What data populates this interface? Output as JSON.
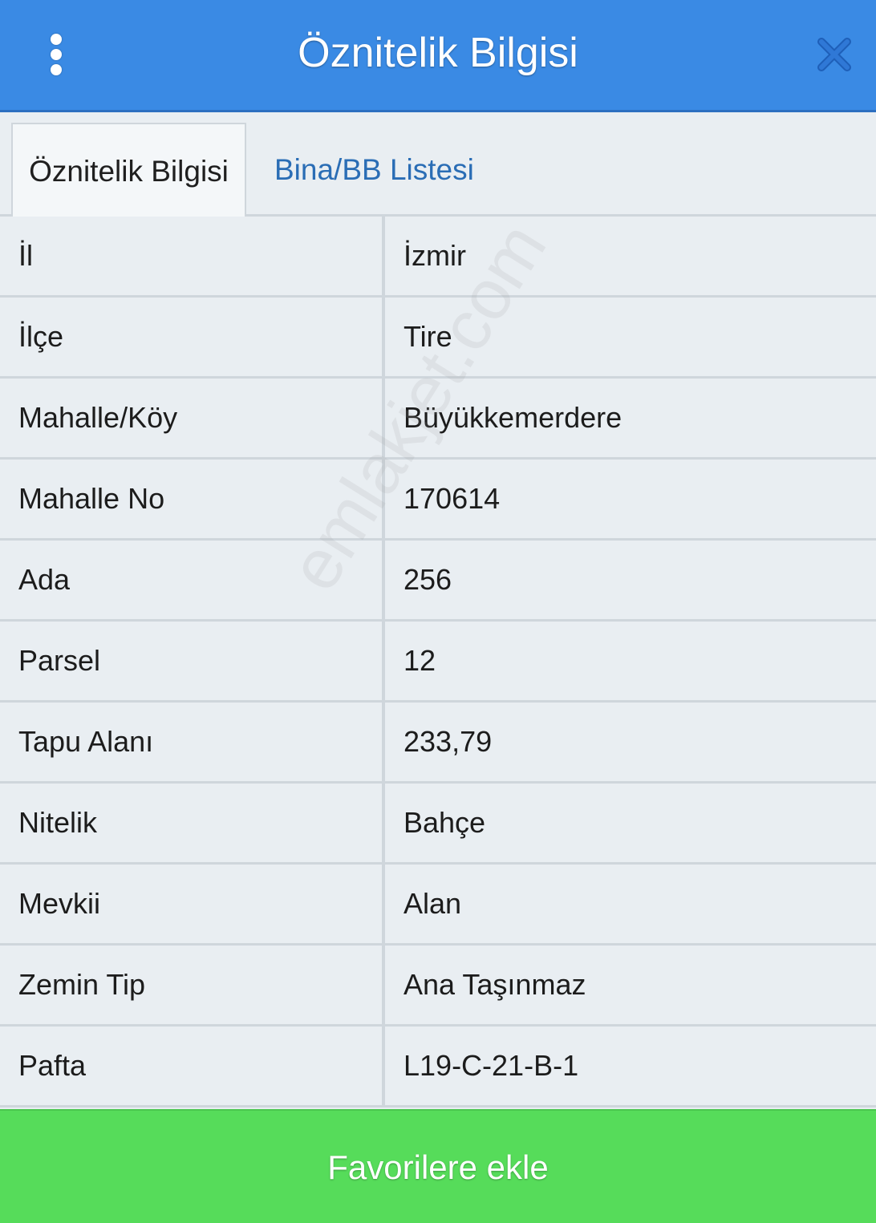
{
  "header": {
    "title": "Öznitelik Bilgisi",
    "menu_icon": "more-vertical-icon",
    "close_icon": "close-icon",
    "color": "#3a8ae4"
  },
  "tabs": [
    {
      "label": "Öznitelik Bilgisi",
      "active": true
    },
    {
      "label": "Bina/BB Listesi",
      "active": false
    }
  ],
  "rows": [
    {
      "key": "İl",
      "value": "İzmir"
    },
    {
      "key": "İlçe",
      "value": "Tire"
    },
    {
      "key": "Mahalle/Köy",
      "value": "Büyükkemerdere"
    },
    {
      "key": "Mahalle No",
      "value": "170614"
    },
    {
      "key": "Ada",
      "value": "256"
    },
    {
      "key": "Parsel",
      "value": "12"
    },
    {
      "key": "Tapu Alanı",
      "value": "233,79"
    },
    {
      "key": "Nitelik",
      "value": "Bahçe"
    },
    {
      "key": "Mevkii",
      "value": "Alan"
    },
    {
      "key": "Zemin Tip",
      "value": "Ana Taşınmaz"
    },
    {
      "key": "Pafta",
      "value": "L19-C-21-B-1"
    }
  ],
  "watermark": "emlakjet.com",
  "footer": {
    "favorite_label": "Favorilere ekle",
    "color": "#56dc5a"
  }
}
